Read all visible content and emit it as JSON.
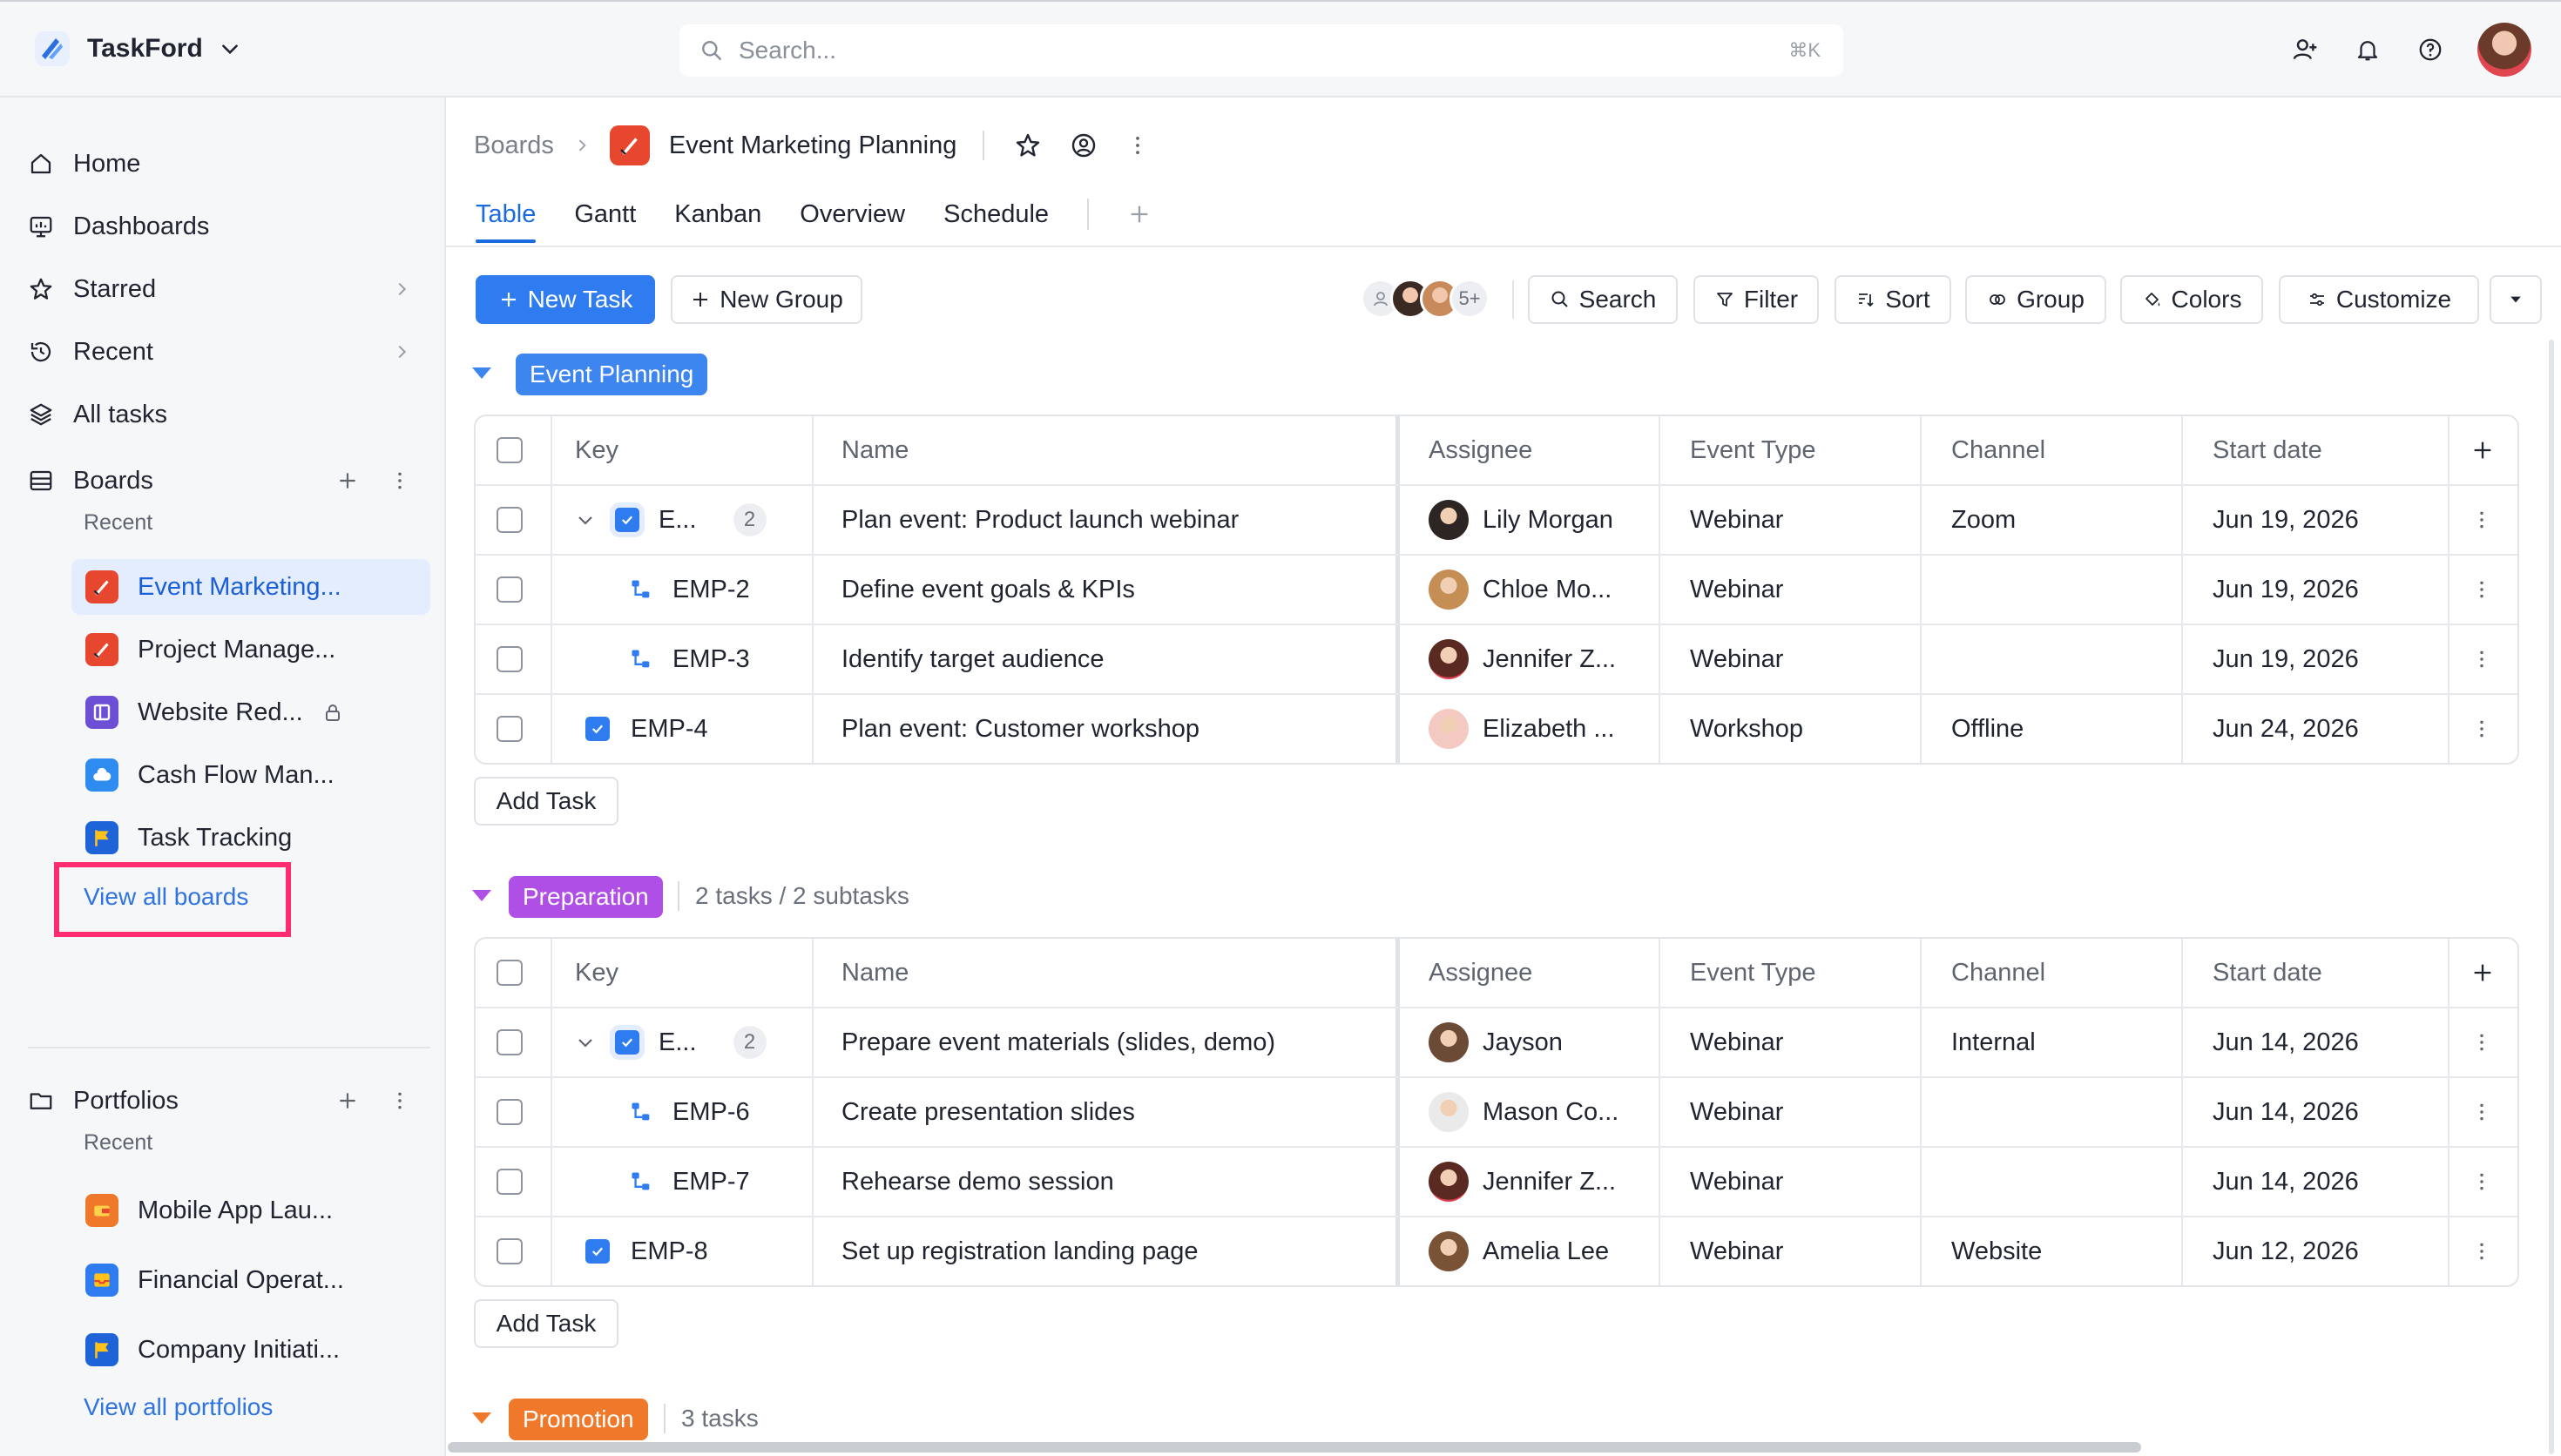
{
  "app": {
    "name": "TaskFord"
  },
  "search": {
    "placeholder": "Search...",
    "shortcut": "⌘K"
  },
  "sidebar": {
    "nav": [
      {
        "label": "Home"
      },
      {
        "label": "Dashboards"
      },
      {
        "label": "Starred"
      },
      {
        "label": "Recent"
      },
      {
        "label": "All tasks"
      }
    ],
    "boards_section": {
      "label": "Boards",
      "recent_label": "Recent",
      "items": [
        {
          "label": "Event Marketing..."
        },
        {
          "label": "Project Manage..."
        },
        {
          "label": "Website Red..."
        },
        {
          "label": "Cash Flow Man..."
        },
        {
          "label": "Task Tracking"
        }
      ],
      "view_all": "View all boards"
    },
    "portfolios_section": {
      "label": "Portfolios",
      "recent_label": "Recent",
      "items": [
        {
          "label": "Mobile App Lau..."
        },
        {
          "label": "Financial Operat..."
        },
        {
          "label": "Company Initiati..."
        }
      ],
      "view_all": "View all portfolios"
    }
  },
  "header": {
    "breadcrumb_root": "Boards",
    "board_title": "Event Marketing Planning",
    "tabs": [
      {
        "label": "Table",
        "active": true
      },
      {
        "label": "Gantt"
      },
      {
        "label": "Kanban"
      },
      {
        "label": "Overview"
      },
      {
        "label": "Schedule"
      }
    ]
  },
  "toolbar": {
    "new_task": "New Task",
    "new_group": "New Group",
    "members_more": "5+",
    "search": "Search",
    "filter": "Filter",
    "sort": "Sort",
    "group": "Group",
    "colors": "Colors",
    "customize": "Customize"
  },
  "columns": [
    "Key",
    "Name",
    "Assignee",
    "Event Type",
    "Channel",
    "Start date"
  ],
  "groups": [
    {
      "name": "Event Planning",
      "color": "#3d86f0",
      "meta": "",
      "add_task": "Add Task",
      "rows": [
        {
          "key": "E...",
          "count": "2",
          "name": "Plan event: Product launch webinar",
          "assignee": "Lily Morgan",
          "event_type": "Webinar",
          "channel": "Zoom",
          "start": "Jun 19, 2026"
        },
        {
          "key": "EMP-2",
          "name": "Define event goals & KPIs",
          "assignee": "Chloe Mo...",
          "event_type": "Webinar",
          "channel": "",
          "start": "Jun 19, 2026"
        },
        {
          "key": "EMP-3",
          "name": "Identify target audience",
          "assignee": "Jennifer Z...",
          "event_type": "Webinar",
          "channel": "",
          "start": "Jun 19, 2026"
        },
        {
          "key": "EMP-4",
          "name": "Plan event: Customer workshop",
          "assignee": "Elizabeth ...",
          "event_type": "Workshop",
          "channel": "Offline",
          "start": "Jun 24, 2026"
        }
      ]
    },
    {
      "name": "Preparation",
      "color": "#b04fe6",
      "meta": "2 tasks / 2 subtasks",
      "add_task": "Add Task",
      "rows": [
        {
          "key": "E...",
          "count": "2",
          "name": "Prepare event materials (slides, demo)",
          "assignee": "Jayson",
          "event_type": "Webinar",
          "channel": "Internal",
          "start": "Jun 14, 2026"
        },
        {
          "key": "EMP-6",
          "name": "Create presentation slides",
          "assignee": "Mason Co...",
          "event_type": "Webinar",
          "channel": "",
          "start": "Jun 14, 2026"
        },
        {
          "key": "EMP-7",
          "name": "Rehearse demo session",
          "assignee": "Jennifer Z...",
          "event_type": "Webinar",
          "channel": "",
          "start": "Jun 14, 2026"
        },
        {
          "key": "EMP-8",
          "name": "Set up registration landing page",
          "assignee": "Amelia Lee",
          "event_type": "Webinar",
          "channel": "Website",
          "start": "Jun 12, 2026"
        }
      ]
    },
    {
      "name": "Promotion",
      "color": "#f0782a",
      "meta": "3 tasks"
    }
  ]
}
